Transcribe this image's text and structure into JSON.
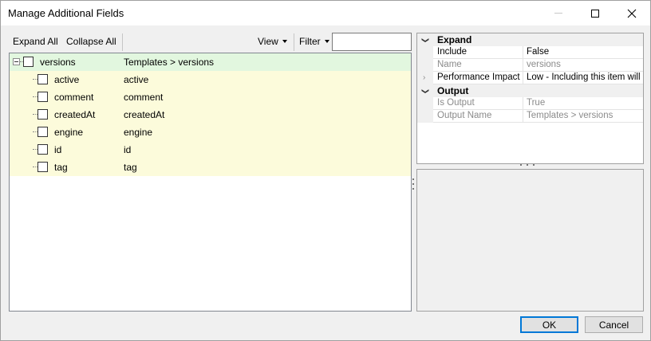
{
  "window": {
    "title": "Manage Additional Fields"
  },
  "toolbar": {
    "expand_all": "Expand All",
    "collapse_all": "Collapse All",
    "view": "View",
    "filter": "Filter",
    "filter_value": ""
  },
  "tree": {
    "root": {
      "label": "versions",
      "path": "Templates > versions",
      "checked": false,
      "expanded": true
    },
    "children": [
      {
        "label": "active",
        "path": "active",
        "checked": false
      },
      {
        "label": "comment",
        "path": "comment",
        "checked": false
      },
      {
        "label": "createdAt",
        "path": "createdAt",
        "checked": false
      },
      {
        "label": "engine",
        "path": "engine",
        "checked": false
      },
      {
        "label": "id",
        "path": "id",
        "checked": false
      },
      {
        "label": "tag",
        "path": "tag",
        "checked": false
      }
    ]
  },
  "properties": {
    "expand_category": "Expand",
    "include_name": "Include",
    "include_value": "False",
    "name_name": "Name",
    "name_value": "versions",
    "perf_name": "Performance Impact",
    "perf_value": "Low - Including this item will hav",
    "output_category": "Output",
    "is_output_name": "Is Output",
    "is_output_value": "True",
    "output_name_name": "Output Name",
    "output_name_value": "Templates > versions"
  },
  "buttons": {
    "ok": "OK",
    "cancel": "Cancel"
  },
  "colors": {
    "root_row_bg": "#e2f7df",
    "child_row_bg": "#fcfbdb",
    "ok_border": "#0078d7"
  }
}
